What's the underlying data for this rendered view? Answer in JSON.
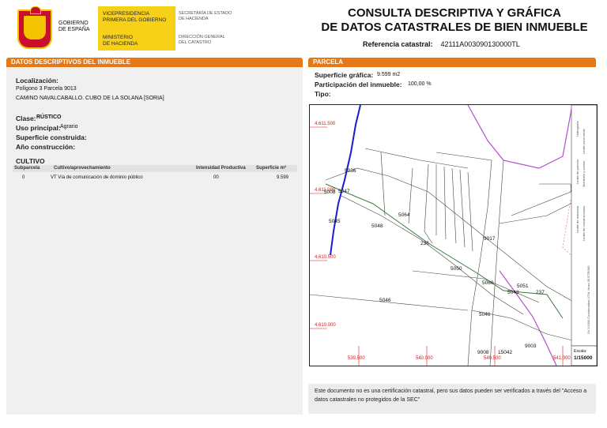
{
  "header": {
    "gobierno": "GOBIERNO\nDE ESPAÑA",
    "vice": "VICEPRESIDENCIA\nPRIMERA DEL GOBIERNO",
    "ministerio": "MINISTERIO\nDE HACIENDA",
    "secretaria": "SECRETARÍA DE ESTADO\nDE HACIENDA",
    "direccion": "DIRECCIÓN GENERAL\nDEL CATASTRO",
    "title_line1": "CONSULTA DESCRIPTIVA Y GRÁFICA",
    "title_line2": "DE DATOS CATASTRALES DE BIEN INMUEBLE",
    "ref_label": "Referencia catastral:",
    "ref_value": "42111A003090130000TL"
  },
  "left": {
    "section_title": "DATOS DESCRIPTIVOS DEL INMUEBLE",
    "localizacion_label": "Localización:",
    "localizacion_l1": "Polígono 3 Parcela 9013",
    "localizacion_l2": "CAMINO NAVALCABALLO. CUBO DE LA SOLANA [SORIA]",
    "clase_label": "Clase:",
    "clase_value": "RÚSTICO",
    "uso_label": "Uso principal:",
    "uso_value": "Agrario",
    "superficie_label": "Superficie construida:",
    "anio_label": "Año construcción:",
    "cultivo_title": "CULTIVO",
    "table_headers": [
      "Subparcela",
      "Cultivo/aprovechamiento",
      "Intensidad Productiva",
      "Superficie m²"
    ],
    "table_rows": [
      [
        "0",
        "VT Vía de comunicación de dominio público",
        "00",
        "9.599"
      ]
    ]
  },
  "right": {
    "section_title": "PARCELA",
    "sup_grafica_label": "Superficie gráfica:",
    "sup_grafica_value": "9.599 m2",
    "participacion_label": "Participación del inmueble:",
    "participacion_value": "100,00 %",
    "tipo_label": "Tipo:",
    "scale_label": "Escala:",
    "scale_value": "1/15000",
    "side_legend": [
      "Hidrografía",
      "Límite zona verde",
      "Límite de parcela",
      "Mobiliario y aceras",
      "Límite de manzana",
      "Límite de construcciones",
      "S4 1:5000 Coordenadas UTM, Huso 30 ETRS89"
    ],
    "y_ticks": [
      "4.611.500",
      "4.611.000",
      "4.610.500",
      "4.610.000"
    ],
    "x_ticks": [
      "539.500",
      "540.000",
      "540.500",
      "541.000"
    ],
    "parcel_labels": [
      "5036",
      "5008",
      "5047",
      "5064",
      "5045",
      "5048",
      "236",
      "9017",
      "5050",
      "5060",
      "5051",
      "5043",
      "237",
      "5046",
      "5046",
      "9008",
      "15042",
      "9003"
    ]
  },
  "notice": "Este documento no es una certificación catastral, pero sus datos pueden ser verificados a través del \"Acceso a datos catastrales no protegidos de la SEC\"",
  "colors": {
    "accent": "#e77817",
    "panel": "#f0f0f0",
    "hydro": "#1b1bd1",
    "road": "#b050d0",
    "grid": "#d02020"
  }
}
